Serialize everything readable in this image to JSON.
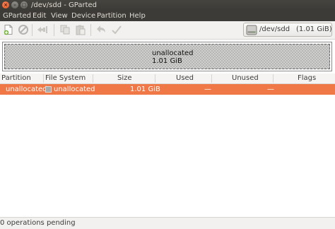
{
  "window": {
    "title": "/dev/sdd - GParted",
    "close_glyph": "×",
    "minimize_glyph": "–",
    "maximize_glyph": "□"
  },
  "menu": {
    "items": [
      "GParted",
      "Edit",
      "View",
      "Device",
      "Partition",
      "Help"
    ]
  },
  "toolbar": {
    "buttons": [
      "new-partition",
      "delete",
      "resize-move",
      "copy",
      "paste",
      "undo",
      "apply"
    ],
    "icons": [
      "new-partition-icon",
      "delete-icon",
      "resize-icon",
      "copy-icon",
      "paste-icon",
      "undo-icon",
      "apply-icon"
    ]
  },
  "device": {
    "path": "/dev/sdd",
    "size": "(1.01 GiB)",
    "icon": "drive-icon"
  },
  "disk_map": {
    "partition_name": "unallocated",
    "partition_size": "1.01 GiB"
  },
  "table": {
    "headers": {
      "partition": "Partition",
      "filesystem": "File System",
      "size": "Size",
      "used": "Used",
      "unused": "Unused",
      "flags": "Flags"
    },
    "rows": [
      {
        "partition": "unallocated",
        "filesystem": "unallocated",
        "size": "1.01 GiB",
        "used": "—",
        "unused": "—",
        "flags": ""
      }
    ]
  },
  "status": {
    "text": "0 operations pending"
  },
  "colors": {
    "selection": "#f07746",
    "titlebar": "#3c3b37",
    "close_button": "#e5541d"
  }
}
